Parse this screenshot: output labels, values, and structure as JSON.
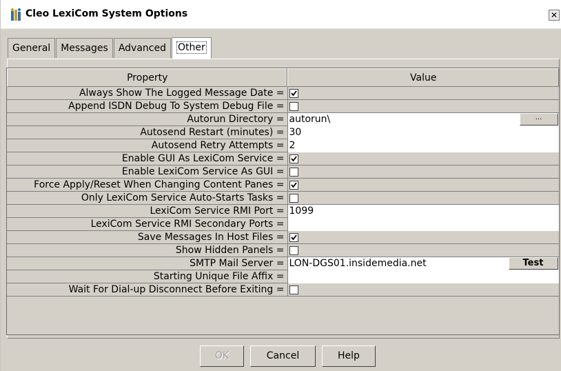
{
  "window": {
    "title": "Cleo LexiCom System Options",
    "close_glyph": "✕"
  },
  "tabs": [
    {
      "label": "General",
      "active": false
    },
    {
      "label": "Messages",
      "active": false
    },
    {
      "label": "Advanced",
      "active": false
    },
    {
      "label": "Other",
      "active": true
    }
  ],
  "table": {
    "columns": {
      "property": "Property",
      "value": "Value"
    },
    "rows": [
      {
        "label": "Always Show The Logged Message Date =",
        "type": "checkbox",
        "checked": true
      },
      {
        "label": "Append ISDN Debug To System Debug File =",
        "type": "checkbox",
        "checked": false
      },
      {
        "label": "Autorun Directory =",
        "type": "text-button",
        "value": "autorun\\",
        "button": "..."
      },
      {
        "label": "Autosend Restart (minutes) =",
        "type": "text",
        "value": "30"
      },
      {
        "label": "Autosend Retry Attempts =",
        "type": "text",
        "value": "2"
      },
      {
        "label": "Enable GUI As LexiCom Service =",
        "type": "checkbox",
        "checked": true
      },
      {
        "label": "Enable LexiCom Service As GUI =",
        "type": "checkbox",
        "checked": false
      },
      {
        "label": "Force Apply/Reset When Changing Content Panes =",
        "type": "checkbox",
        "checked": true
      },
      {
        "label": "Only LexiCom Service Auto-Starts Tasks =",
        "type": "checkbox",
        "checked": false
      },
      {
        "label": "LexiCom Service RMI Port =",
        "type": "text",
        "value": "1099"
      },
      {
        "label": "LexiCom Service RMI Secondary Ports =",
        "type": "text",
        "value": ""
      },
      {
        "label": "Save Messages In Host Files =",
        "type": "checkbox",
        "checked": true
      },
      {
        "label": "Show Hidden Panels =",
        "type": "checkbox",
        "checked": false
      },
      {
        "label": "SMTP Mail Server =",
        "type": "text-button",
        "value": "LON-DGS01.insidemedia.net",
        "button": "Test"
      },
      {
        "label": "Starting Unique File Affix =",
        "type": "text",
        "value": ""
      },
      {
        "label": "Wait For Dial-up Disconnect Before Exiting =",
        "type": "checkbox",
        "checked": false
      }
    ]
  },
  "buttons": {
    "ok": "OK",
    "cancel": "Cancel",
    "help": "Help"
  },
  "colors": {
    "dialog_bg": "#d4d0c8",
    "edit_bg": "#ffffff",
    "check_mark": "#000000"
  }
}
